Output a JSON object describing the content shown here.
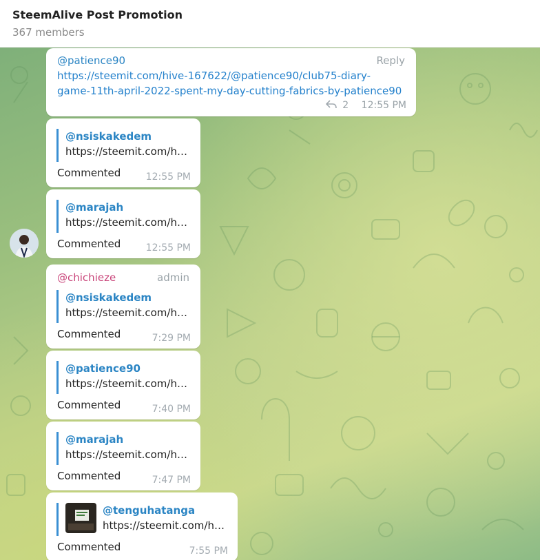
{
  "header": {
    "title": "SteemAlive Post Promotion",
    "subtitle": "367 members"
  },
  "messages": [
    {
      "sender": "@patience90",
      "side_tag": "Reply",
      "link_line1": "https://steemit.com/hive-167622/@patience90/club75-diary-",
      "link_line2": "game-11th-april-2022-spent-my-day-cutting-fabrics-by-patience90",
      "replies_count": "2",
      "time": "12:55 PM"
    },
    {
      "quote_author": "@nsiskakedem",
      "quote_text": "https://steemit.com/h…",
      "text": "Commented",
      "time": "12:55 PM"
    },
    {
      "quote_author": "@marajah",
      "quote_text": "https://steemit.com/h…",
      "text": "Commented",
      "time": "12:55 PM"
    },
    {
      "sender": "@chichieze",
      "side_tag": "admin",
      "quote_author": "@nsiskakedem",
      "quote_text": "https://steemit.com/h…",
      "text": "Commented",
      "time": "7:29 PM"
    },
    {
      "quote_author": "@patience90",
      "quote_text": "https://steemit.com/h…",
      "text": "Commented",
      "time": "7:40 PM"
    },
    {
      "quote_author": "@marajah",
      "quote_text": "https://steemit.com/h…",
      "text": "Commented",
      "time": "7:47 PM"
    },
    {
      "quote_author": "@tenguhatanga",
      "quote_text": "https://steemit.com/h…",
      "text": "Commented",
      "time": "7:55 PM"
    }
  ],
  "icons": {
    "reply": "reply-arrow-icon",
    "avatar": "user-avatar",
    "thumbnail": "quote-thumbnail-image"
  },
  "colors": {
    "link": "#2481cc",
    "sender": "#2b85c4",
    "admin_sender": "#c9457a",
    "quote_bar": "#3a8fd3"
  }
}
